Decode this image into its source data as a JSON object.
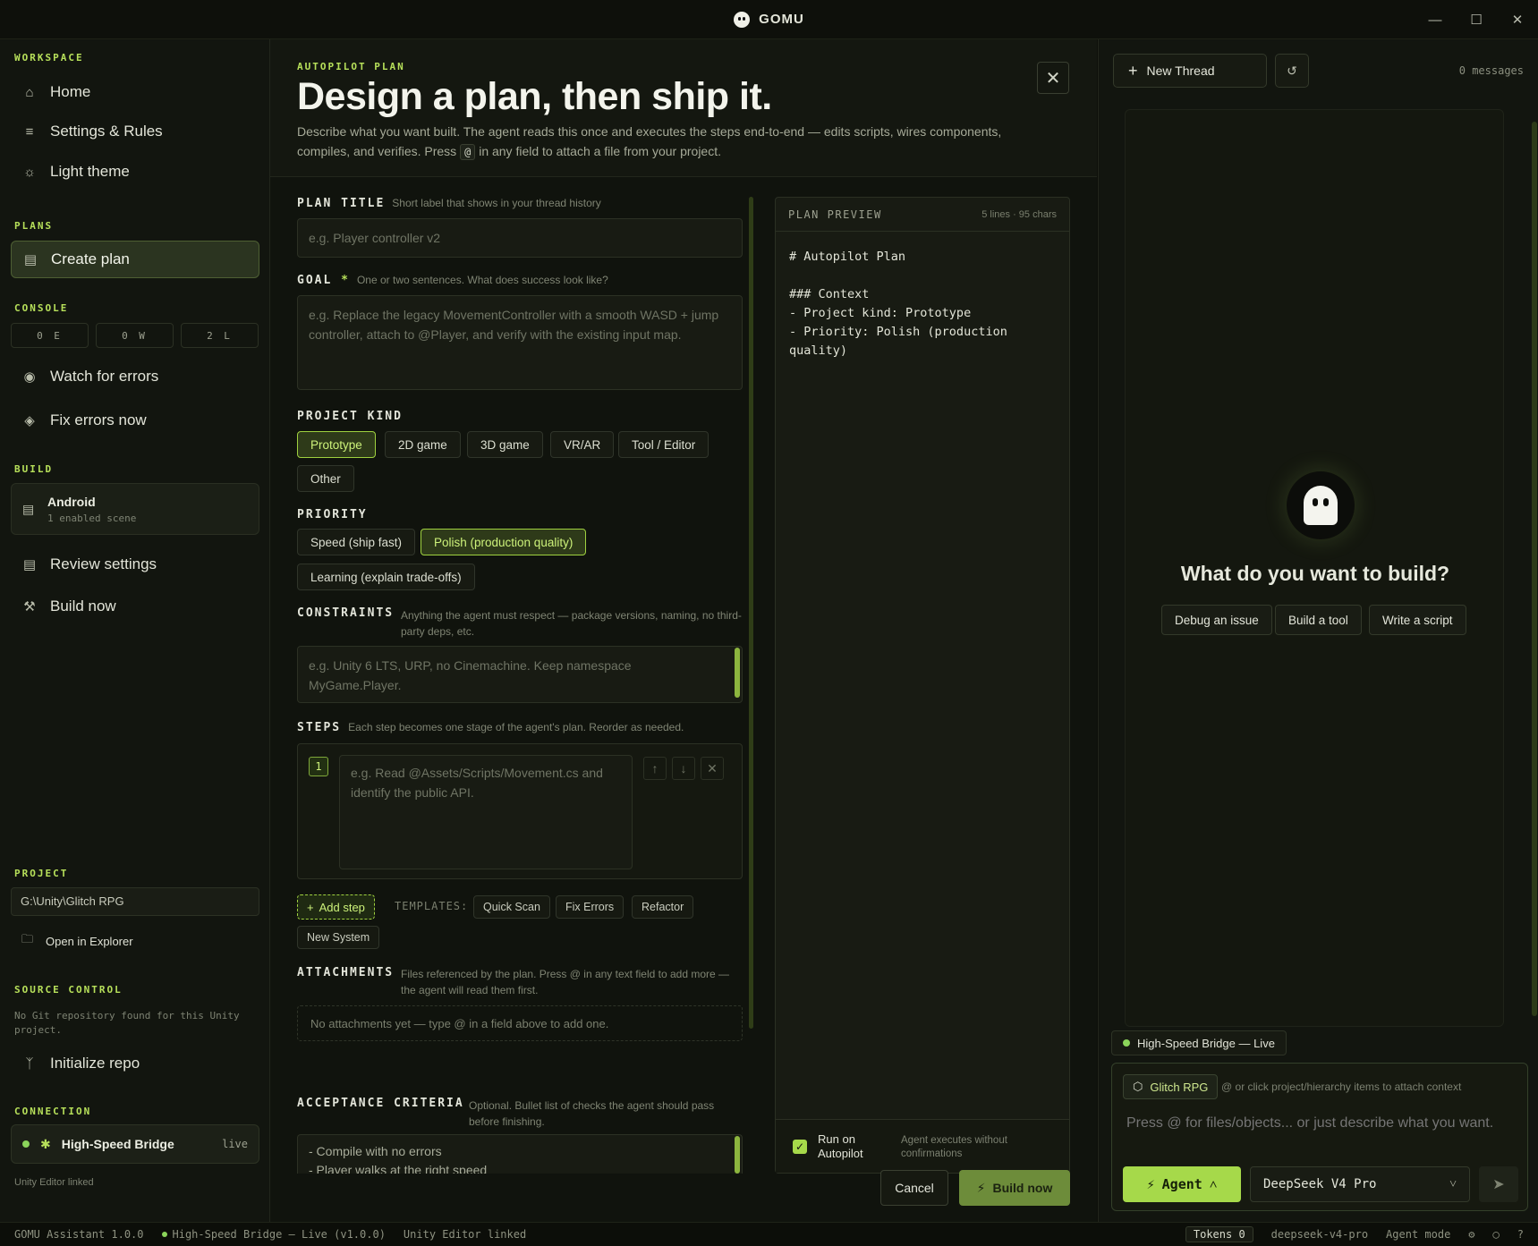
{
  "titlebar": {
    "app_name": "GOMU",
    "icons": {
      "minimize": "minimize-icon",
      "maximize": "maximize-icon",
      "close": "close-icon"
    }
  },
  "sidebar": {
    "workspace_label": "WORKSPACE",
    "workspace_items": [
      {
        "label": "Home",
        "icon": "home-icon"
      },
      {
        "label": "Settings & Rules",
        "icon": "sliders-icon"
      },
      {
        "label": "Light theme",
        "icon": "sun-icon"
      }
    ],
    "plans_label": "PLANS",
    "create_plan": "Create plan",
    "console_label": "CONSOLE",
    "console_counts": [
      "0 E",
      "0 W",
      "2 L"
    ],
    "console_items": [
      {
        "label": "Watch for errors",
        "icon": "eye-off-icon"
      },
      {
        "label": "Fix errors now",
        "icon": "bug-icon"
      }
    ],
    "build_label": "BUILD",
    "build_target": {
      "platform": "Android",
      "scenes": "1 enabled scene"
    },
    "build_items": [
      {
        "label": "Review settings",
        "icon": "list-icon"
      },
      {
        "label": "Build now",
        "icon": "hammer-icon"
      }
    ],
    "project_label": "PROJECT",
    "project_path": "G:\\Unity\\Glitch RPG",
    "open_explorer": "Open in Explorer",
    "source_control_label": "SOURCE CONTROL",
    "source_control_note": "No Git repository found for this Unity project.",
    "init_repo": "Initialize repo",
    "connection_label": "CONNECTION",
    "connection": {
      "name": "High-Speed Bridge",
      "state": "live",
      "note": "Unity Editor linked"
    }
  },
  "plan": {
    "eyebrow": "AUTOPILOT PLAN",
    "title": "Design a plan, then ship it.",
    "intro_a": "Describe what you want built. The agent reads this once and executes the steps end-to-end — edits scripts, wires components, compiles, and verifies. Press",
    "intro_key": "@",
    "intro_b": "in any field to attach a file from your project.",
    "plan_title_label": "PLAN TITLE",
    "plan_title_hint": "Short label that shows in your thread history",
    "plan_title_placeholder": "e.g. Player controller v2",
    "goal_label": "GOAL",
    "goal_required": "*",
    "goal_hint": "One or two sentences. What does success look like?",
    "goal_placeholder": "e.g. Replace the legacy MovementController with a smooth WASD + jump controller, attach to @Player, and verify with the existing input map.",
    "kind_label": "PROJECT KIND",
    "kinds": [
      "Prototype",
      "2D game",
      "3D game",
      "VR/AR",
      "Tool / Editor",
      "Other"
    ],
    "kind_selected": "Prototype",
    "priority_label": "PRIORITY",
    "priorities": [
      "Speed (ship fast)",
      "Polish (production quality)",
      "Learning (explain trade-offs)"
    ],
    "priority_selected": "Polish (production quality)",
    "constraints_label": "CONSTRAINTS",
    "constraints_hint": "Anything the agent must respect — package versions, naming, no third-party deps, etc.",
    "constraints_placeholder": "e.g. Unity 6 LTS, URP, no Cinemachine. Keep namespace MyGame.Player.",
    "steps_label": "STEPS",
    "steps_hint": "Each step becomes one stage of the agent's plan. Reorder as needed.",
    "steps": [
      {
        "number": "1",
        "placeholder": "e.g. Read @Assets/Scripts/Movement.cs and identify the public API."
      }
    ],
    "add_step": "Add step",
    "templates_label": "TEMPLATES:",
    "templates": [
      "Quick Scan",
      "Fix Errors",
      "Refactor",
      "New System"
    ],
    "attachments_label": "ATTACHMENTS",
    "attachments_hint": "Files referenced by the plan. Press @ in any text field to add more — the agent will read them first.",
    "attachments_empty": "No attachments yet — type @ in a field above to add one.",
    "acceptance_label": "ACCEPTANCE CRITERIA",
    "acceptance_hint": "Optional. Bullet list of checks the agent should pass before finishing.",
    "acceptance_line1": "- Compile with no errors",
    "acceptance_line2": "- Player walks at the right speed",
    "cancel": "Cancel",
    "build_now": "Build now"
  },
  "preview": {
    "title": "PLAN PREVIEW",
    "meta": "5 lines · 95 chars",
    "content": "# Autopilot Plan\n\n### Context\n- Project kind: Prototype\n- Priority: Polish (production quality)",
    "autopilot_label": "Run on Autopilot",
    "autopilot_checked": true,
    "autopilot_note": "Agent executes without confirmations"
  },
  "chat": {
    "new_thread": "New Thread",
    "message_count": "0 messages",
    "empty_title": "What do you want to build?",
    "suggestions": [
      "Debug an issue",
      "Build a tool",
      "Write a script"
    ],
    "bridge_pill": "High-Speed Bridge — Live",
    "context_chip": "Glitch RPG",
    "context_hint": "@ or click project/hierarchy items to attach context",
    "input_placeholder": "Press @ for files/objects... or just describe what you want.",
    "mode": "Agent",
    "model": "DeepSeek V4 Pro"
  },
  "statusbar": {
    "version": "GOMU Assistant 1.0.0",
    "bridge": "High-Speed Bridge — Live (v1.0.0)",
    "editor": "Unity Editor linked",
    "tokens": "Tokens 0",
    "model": "deepseek-v4-pro",
    "mode": "Agent mode"
  },
  "colors": {
    "accent": "#a6d94a",
    "background": "#10130d",
    "panel": "#12150f"
  }
}
